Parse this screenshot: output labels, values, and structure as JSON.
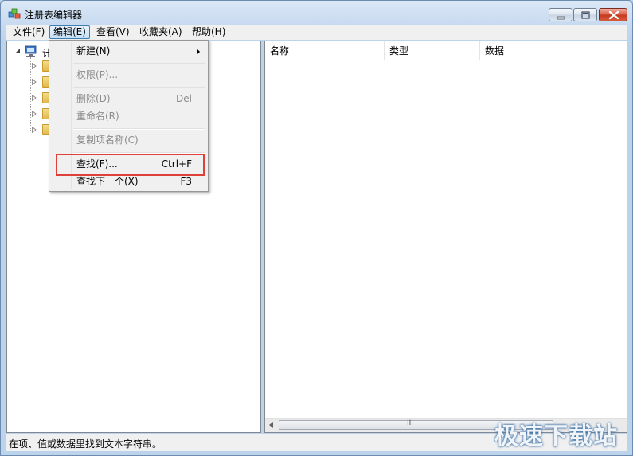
{
  "window": {
    "title": "注册表编辑器"
  },
  "menubar": {
    "items": [
      {
        "label": "文件(F)"
      },
      {
        "label": "编辑(E)"
      },
      {
        "label": "查看(V)"
      },
      {
        "label": "收藏夹(A)"
      },
      {
        "label": "帮助(H)"
      }
    ]
  },
  "tree": {
    "root_label": "计"
  },
  "list": {
    "columns": [
      "名称",
      "类型",
      "数据"
    ],
    "scroll_glyph": "III"
  },
  "edit_menu": {
    "items": [
      {
        "label": "新建(N)",
        "shortcut": "",
        "enabled": true,
        "submenu": true
      },
      {
        "label": "权限(P)...",
        "shortcut": "",
        "enabled": false
      },
      {
        "label": "删除(D)",
        "shortcut": "Del",
        "enabled": false
      },
      {
        "label": "重命名(R)",
        "shortcut": "",
        "enabled": false
      },
      {
        "label": "复制项名称(C)",
        "shortcut": "",
        "enabled": false
      },
      {
        "label": "查找(F)...",
        "shortcut": "Ctrl+F",
        "enabled": true
      },
      {
        "label": "查找下一个(X)",
        "shortcut": "F3",
        "enabled": true
      }
    ]
  },
  "statusbar": {
    "text": "在项、值或数据里找到文本字符串。"
  },
  "watermark": {
    "text": "极速下载站"
  },
  "colors": {
    "highlight_border": "#e0403a",
    "menu_active_border": "#3c7fb1"
  }
}
